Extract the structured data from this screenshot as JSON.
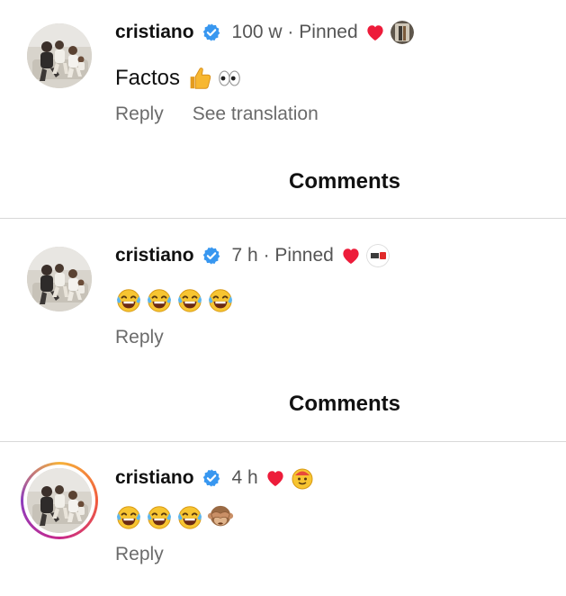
{
  "comments": [
    {
      "username": "cristiano",
      "time": "100 w",
      "pinned_label": "Pinned",
      "text": "Factos",
      "emojis": [
        "thumbs-up",
        "eyes"
      ],
      "liker_icon": "user-avatar-small",
      "actions": {
        "reply": "Reply",
        "see_translation": "See translation"
      }
    },
    {
      "username": "cristiano",
      "time": "7 h",
      "pinned_label": "Pinned",
      "emojis": [
        "tears-of-joy",
        "tears-of-joy",
        "tears-of-joy",
        "tears-of-joy"
      ],
      "liker_icon": "brand-logo-badge",
      "actions": {
        "reply": "Reply"
      }
    },
    {
      "username": "cristiano",
      "time": "4 h",
      "emojis": [
        "tears-of-joy",
        "tears-of-joy",
        "tears-of-joy",
        "see-no-evil-monkey"
      ],
      "liker_icon": "emoji-avatar",
      "actions": {
        "reply": "Reply"
      }
    }
  ],
  "section_titles": {
    "comments_1": "Comments",
    "comments_2": "Comments"
  },
  "separator": "·",
  "colors": {
    "verified_blue": "#3897f0",
    "heart_red": "#ed1c3a",
    "meta_gray": "#555555",
    "action_gray": "#6b6b6b",
    "divider": "#d8d8d8"
  }
}
